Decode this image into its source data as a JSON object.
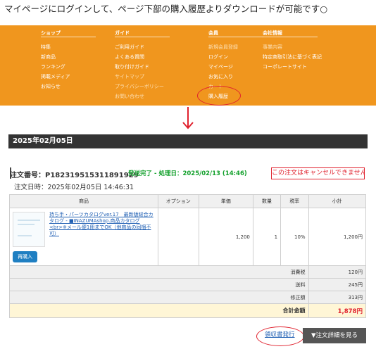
{
  "headline": "マイページにログインして、ページ下部の購入履歴よりダウンロードが可能です○",
  "nav": {
    "columns": [
      {
        "title": "ショップ",
        "items": [
          "特集",
          "新商品",
          "ランキング",
          "掲載メディア",
          "お知らせ"
        ]
      },
      {
        "title": "ガイド",
        "items": [
          "ご利用ガイド",
          "よくある質問",
          "取り付けガイド",
          "サイトマップ",
          "プライバシーポリシー",
          "お問い合わせ"
        ]
      },
      {
        "title": "会員",
        "items": [
          "新規会員登録",
          "ログイン",
          "マイページ",
          "お気に入り",
          "カート",
          "購入履歴"
        ]
      },
      {
        "title": "会社情報",
        "items": [
          "事業内容",
          "特定商取引法に基づく表記",
          "コーポレートサイト"
        ]
      }
    ]
  },
  "date_header": "2025年02月05日",
  "order": {
    "number_label": "注文番号：",
    "number": "P182319515311891929",
    "status": "発送完了 - 処理日：2025/02/13 (14:46)",
    "cancel_note": "この注文はキャンセルできません",
    "date_label": "注文日時：",
    "date": "2025年02月05日 14:46:31"
  },
  "table": {
    "headers": [
      "商品",
      "オプション",
      "単価",
      "数量",
      "税率",
      "小計"
    ],
    "item": {
      "name": "持ち手・パーツカタログver.17　最新版総合カタログ - ■INAZUMAshop.商品カタログ<br>※メール便1冊までOK（他商品の同梱不可）",
      "option": "",
      "price": "1,200",
      "qty": "1",
      "tax": "10%",
      "subtotal": "1,200円",
      "rebuy": "再購入"
    },
    "summary": [
      {
        "label": "消費税",
        "value": "120円"
      },
      {
        "label": "送料",
        "value": "245円"
      },
      {
        "label": "修正額",
        "value": "313円"
      }
    ],
    "total_label": "合計金額",
    "total_value": "1,878円"
  },
  "buttons": {
    "receipt": "領収書発行",
    "detail": "▼注文詳細を見る"
  },
  "colors": {
    "banner": "#f0961e",
    "annotation": "#e0222e",
    "total": "#e0222e",
    "status": "#12a02b"
  }
}
